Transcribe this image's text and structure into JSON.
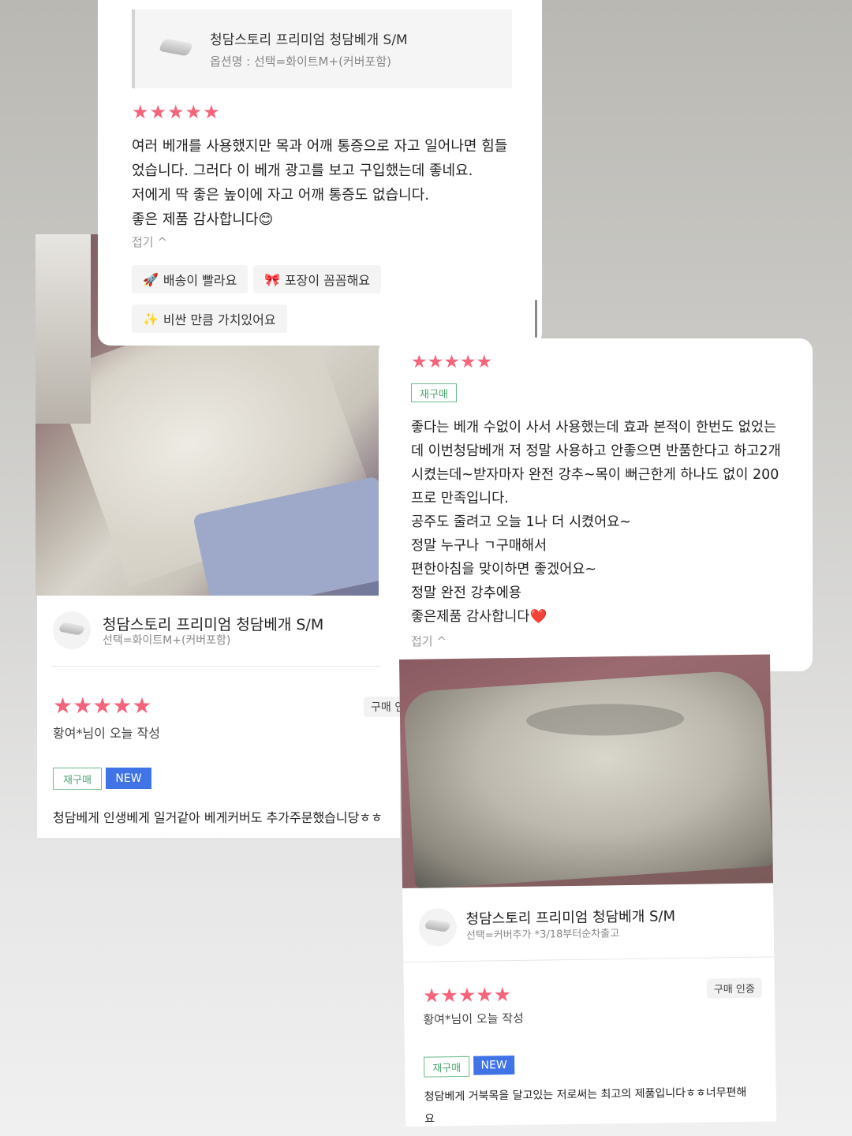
{
  "card1": {
    "product_title": "청담스토리 프리미엄 청담베개 S/M",
    "option": "옵션명 : 선택=화이트M+(커버포함)",
    "stars": "★★★★★",
    "review_lines": [
      "여러 베개를 사용했지만 목과 어깨 통증으로 자고 일어나면 힘들",
      "었습니다. 그러다 이 베개 광고를 보고 구입했는데 좋네요.",
      "저에게 딱 좋은 높이에 자고 어깨 통증도 없습니다.",
      "좋은 제품 감사합니다😊"
    ],
    "collapse": "접기 ^",
    "tags": [
      {
        "icon": "🚀",
        "label": "배송이 빨라요"
      },
      {
        "icon": "🎀",
        "label": "포장이 꼼꼼해요"
      },
      {
        "icon": "✨",
        "label": "비싼 만큼 가치있어요"
      }
    ]
  },
  "card2": {
    "stars": "★★★★★",
    "badge": "재구매",
    "review_lines": [
      "좋다는 베개 수없이 사서 사용했는데 효과 본적이 한번도 없었는",
      "데 이번청담베개 저 정말 사용하고 안좋으면 반품한다고 하고2개",
      "시켰는데~받자마자 완전 강추~목이 뻐근한게 하나도 없이 200",
      "프로 만족입니다.",
      "공주도 줄려고 오늘 1나 더 시켰어요~",
      "정말 누구나 ㄱ구매해서",
      "편한아침을 맞이하면 좋겠어요~",
      "정말 완전 강추에용",
      "좋은제품 감사합니다❤️"
    ],
    "collapse": "접기 ^"
  },
  "card3": {
    "product_title": "청담스토리 프리미엄 청담베개 S/M",
    "option": "선택=화이트M+(커버포함)",
    "stars": "★★★★★",
    "author": "황여*님이 오늘 작성",
    "verified": "구매 인증",
    "badge_re": "재구매",
    "badge_new": "NEW",
    "review": "청담베게 인생베게 일거같아 베게커버도 추가주문했습니당ㅎㅎ"
  },
  "card4": {
    "product_title": "청담스토리 프리미엄 청담베개 S/M",
    "option": "선택=커버추가 *3/18부터순차출고",
    "stars": "★★★★★",
    "author": "황여*님이 오늘 작성",
    "verified": "구매 인증",
    "badge_re": "재구매",
    "badge_new": "NEW",
    "review_lines": [
      "청담베게 거북목을 달고있는 저로써는 최고의 제품입니다ㅎㅎ너무편해",
      "요"
    ]
  },
  "colors": {
    "star": "#f4647a",
    "new_badge": "#3f73e6",
    "repurchase": "#4aa36e"
  }
}
